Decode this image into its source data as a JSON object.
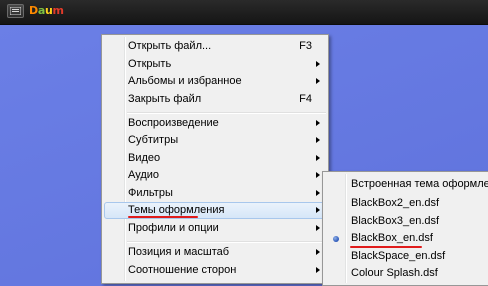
{
  "titlebar": {
    "logo_parts": [
      "D",
      "a",
      "u",
      "m"
    ]
  },
  "main_menu": {
    "items": [
      {
        "label": "Открыть файл...",
        "shortcut": "F3",
        "submenu": false
      },
      {
        "label": "Открыть",
        "shortcut": "",
        "submenu": true
      },
      {
        "label": "Альбомы и избранное",
        "shortcut": "",
        "submenu": true
      },
      {
        "label": "Закрыть файл",
        "shortcut": "F4",
        "submenu": false
      },
      {
        "label": "Воспроизведение",
        "shortcut": "",
        "submenu": true
      },
      {
        "label": "Субтитры",
        "shortcut": "",
        "submenu": true
      },
      {
        "label": "Видео",
        "shortcut": "",
        "submenu": true
      },
      {
        "label": "Аудио",
        "shortcut": "",
        "submenu": true
      },
      {
        "label": "Фильтры",
        "shortcut": "",
        "submenu": true
      },
      {
        "label": "Темы оформления",
        "shortcut": "",
        "submenu": true,
        "highlighted": true
      },
      {
        "label": "Профили и опции",
        "shortcut": "",
        "submenu": true
      },
      {
        "label": "Позиция и масштаб",
        "shortcut": "",
        "submenu": true
      },
      {
        "label": "Соотношение сторон",
        "shortcut": "",
        "submenu": true
      }
    ]
  },
  "skins_menu": {
    "items": [
      {
        "label": "Встроенная тема оформления",
        "checked": false
      },
      {
        "label": "BlackBox2_en.dsf",
        "checked": false
      },
      {
        "label": "BlackBox3_en.dsf",
        "checked": false
      },
      {
        "label": "BlackBox_en.dsf",
        "checked": true
      },
      {
        "label": "BlackSpace_en.dsf",
        "checked": false
      },
      {
        "label": "Colour Splash.dsf",
        "checked": false
      }
    ]
  },
  "colors": {
    "background": "#6678e0",
    "menu_bg": "#f0f0f0",
    "highlight_border": "#a8c7ec",
    "annotation_red": "#e01c1c"
  }
}
